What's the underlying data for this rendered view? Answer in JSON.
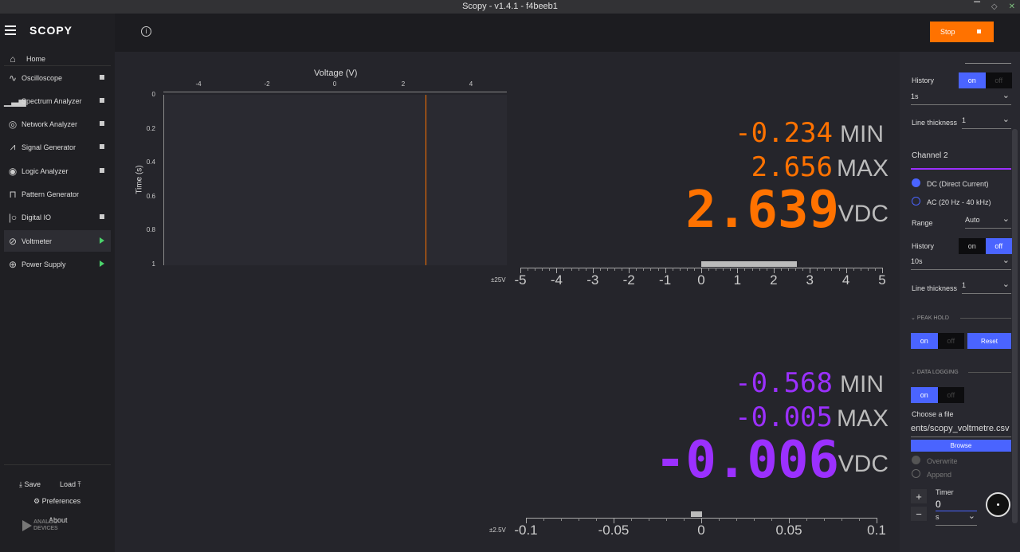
{
  "window": {
    "title": "Scopy - v1.4.1 - f4beeb1"
  },
  "sidebar": {
    "logo": "SCOPY",
    "home": "Home",
    "items": [
      {
        "label": "Oscilloscope",
        "status": "stopped"
      },
      {
        "label": "Spectrum Analyzer",
        "status": "stopped"
      },
      {
        "label": "Network Analyzer",
        "status": "stopped"
      },
      {
        "label": "Signal Generator",
        "status": "stopped"
      },
      {
        "label": "Logic Analyzer",
        "status": "stopped"
      },
      {
        "label": "Pattern Generator",
        "status": "none"
      },
      {
        "label": "Digital IO",
        "status": "stopped"
      },
      {
        "label": "Voltmeter",
        "status": "running"
      },
      {
        "label": "Power Supply",
        "status": "running"
      }
    ],
    "save": "Save",
    "load": "Load",
    "preferences": "Preferences",
    "about": "About",
    "ad_logo_line1": "ANALOG",
    "ad_logo_line2": "DEVICES"
  },
  "toolbar": {
    "stop_label": "Stop",
    "info_icon": "i"
  },
  "history_plot": {
    "xlabel": "Voltage (V)",
    "ylabel": "Time (s)",
    "xticks": [
      "-4",
      "-2",
      "0",
      "2",
      "4"
    ],
    "yticks": [
      "0",
      "0.2",
      "0.4",
      "0.6",
      "0.8",
      "1"
    ]
  },
  "channel1": {
    "color": "#ff7200",
    "min": "-0.234",
    "min_label": "MIN",
    "max": "2.656",
    "max_label": "MAX",
    "value": "2.639",
    "unit": "VDC",
    "range_label": "±25V",
    "scale_ticks": [
      "-5",
      "-4",
      "-3",
      "-2",
      "-1",
      "0",
      "1",
      "2",
      "3",
      "4",
      "5"
    ]
  },
  "channel2": {
    "color": "#9b30ff",
    "min": "-0.568",
    "min_label": "MIN",
    "max": "-0.005",
    "max_label": "MAX",
    "value": "-0.006",
    "unit": "VDC",
    "range_label": "±2.5V",
    "scale_ticks": [
      "-0.1",
      "-0.05",
      "0",
      "0.05",
      "0.1"
    ]
  },
  "panel": {
    "history_label": "History",
    "ch1_history": {
      "on": "on",
      "off": "off"
    },
    "ch1_history_time": "1s",
    "line_thickness_label": "Line thickness",
    "ch1_line_thickness": "1",
    "channel2_title": "Channel 2",
    "dc_label": "DC (Direct Current)",
    "ac_label": "AC (20 Hz - 40 kHz)",
    "range_label": "Range",
    "range_value": "Auto",
    "ch2_history": {
      "on": "on",
      "off": "off"
    },
    "ch2_history_time": "10s",
    "ch2_line_thickness": "1",
    "peak_hold_title": "PEAK HOLD",
    "peak_hold": {
      "on": "on",
      "off": "off"
    },
    "reset_label": "Reset",
    "data_logging_title": "DATA LOGGING",
    "data_logging": {
      "on": "on",
      "off": "off"
    },
    "choose_file_label": "Choose a file",
    "file_path": "ents/scopy_voltmetre.csv",
    "browse_label": "Browse",
    "overwrite_label": "Overwrite",
    "append_label": "Append",
    "timer_label": "Timer",
    "timer_value": "0",
    "timer_unit": "s",
    "plus": "+",
    "minus": "−"
  }
}
